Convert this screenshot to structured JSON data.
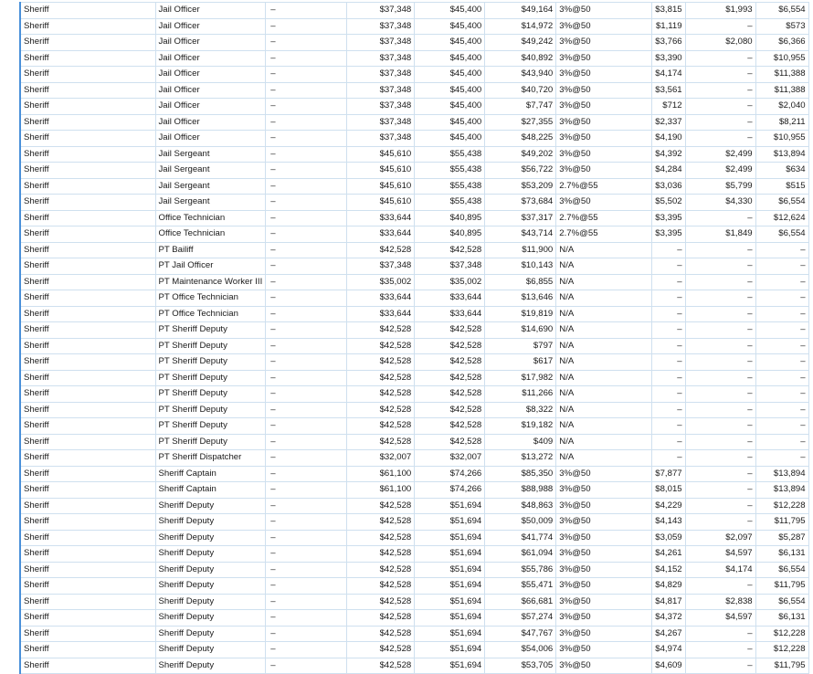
{
  "rows": [
    {
      "dept": "Sheriff",
      "title": "Jail Officer",
      "dash": "–",
      "min": "$37,348",
      "max": "$45,400",
      "pay": "$49,164",
      "ret": "3%@50",
      "h": "$3,815",
      "i": "$1,993",
      "j": "$6,554"
    },
    {
      "dept": "Sheriff",
      "title": "Jail Officer",
      "dash": "–",
      "min": "$37,348",
      "max": "$45,400",
      "pay": "$14,972",
      "ret": "3%@50",
      "h": "$1,119",
      "i": "–",
      "j": "$573"
    },
    {
      "dept": "Sheriff",
      "title": "Jail Officer",
      "dash": "–",
      "min": "$37,348",
      "max": "$45,400",
      "pay": "$49,242",
      "ret": "3%@50",
      "h": "$3,766",
      "i": "$2,080",
      "j": "$6,366"
    },
    {
      "dept": "Sheriff",
      "title": "Jail Officer",
      "dash": "–",
      "min": "$37,348",
      "max": "$45,400",
      "pay": "$40,892",
      "ret": "3%@50",
      "h": "$3,390",
      "i": "–",
      "j": "$10,955"
    },
    {
      "dept": "Sheriff",
      "title": "Jail Officer",
      "dash": "–",
      "min": "$37,348",
      "max": "$45,400",
      "pay": "$43,940",
      "ret": "3%@50",
      "h": "$4,174",
      "i": "–",
      "j": "$11,388"
    },
    {
      "dept": "Sheriff",
      "title": "Jail Officer",
      "dash": "–",
      "min": "$37,348",
      "max": "$45,400",
      "pay": "$40,720",
      "ret": "3%@50",
      "h": "$3,561",
      "i": "–",
      "j": "$11,388"
    },
    {
      "dept": "Sheriff",
      "title": "Jail Officer",
      "dash": "–",
      "min": "$37,348",
      "max": "$45,400",
      "pay": "$7,747",
      "ret": "3%@50",
      "h": "$712",
      "i": "–",
      "j": "$2,040"
    },
    {
      "dept": "Sheriff",
      "title": "Jail Officer",
      "dash": "–",
      "min": "$37,348",
      "max": "$45,400",
      "pay": "$27,355",
      "ret": "3%@50",
      "h": "$2,337",
      "i": "–",
      "j": "$8,211"
    },
    {
      "dept": "Sheriff",
      "title": "Jail Officer",
      "dash": "–",
      "min": "$37,348",
      "max": "$45,400",
      "pay": "$48,225",
      "ret": "3%@50",
      "h": "$4,190",
      "i": "–",
      "j": "$10,955"
    },
    {
      "dept": "Sheriff",
      "title": "Jail Sergeant",
      "dash": "–",
      "min": "$45,610",
      "max": "$55,438",
      "pay": "$49,202",
      "ret": "3%@50",
      "h": "$4,392",
      "i": "$2,499",
      "j": "$13,894"
    },
    {
      "dept": "Sheriff",
      "title": "Jail Sergeant",
      "dash": "–",
      "min": "$45,610",
      "max": "$55,438",
      "pay": "$56,722",
      "ret": "3%@50",
      "h": "$4,284",
      "i": "$2,499",
      "j": "$634"
    },
    {
      "dept": "Sheriff",
      "title": "Jail Sergeant",
      "dash": "–",
      "min": "$45,610",
      "max": "$55,438",
      "pay": "$53,209",
      "ret": "2.7%@55",
      "h": "$3,036",
      "i": "$5,799",
      "j": "$515"
    },
    {
      "dept": "Sheriff",
      "title": "Jail Sergeant",
      "dash": "–",
      "min": "$45,610",
      "max": "$55,438",
      "pay": "$73,684",
      "ret": "3%@50",
      "h": "$5,502",
      "i": "$4,330",
      "j": "$6,554"
    },
    {
      "dept": "Sheriff",
      "title": "Office Technician",
      "dash": "–",
      "min": "$33,644",
      "max": "$40,895",
      "pay": "$37,317",
      "ret": "2.7%@55",
      "h": "$3,395",
      "i": "–",
      "j": "$12,624"
    },
    {
      "dept": "Sheriff",
      "title": "Office Technician",
      "dash": "–",
      "min": "$33,644",
      "max": "$40,895",
      "pay": "$43,714",
      "ret": "2.7%@55",
      "h": "$3,395",
      "i": "$1,849",
      "j": "$6,554"
    },
    {
      "dept": "Sheriff",
      "title": "PT Bailiff",
      "dash": "–",
      "min": "$42,528",
      "max": "$42,528",
      "pay": "$11,900",
      "ret": "N/A",
      "h": "–",
      "i": "–",
      "j": "–"
    },
    {
      "dept": "Sheriff",
      "title": "PT Jail Officer",
      "dash": "–",
      "min": "$37,348",
      "max": "$37,348",
      "pay": "$10,143",
      "ret": "N/A",
      "h": "–",
      "i": "–",
      "j": "–"
    },
    {
      "dept": "Sheriff",
      "title": "PT Maintenance Worker III",
      "dash": "–",
      "min": "$35,002",
      "max": "$35,002",
      "pay": "$6,855",
      "ret": "N/A",
      "h": "–",
      "i": "–",
      "j": "–"
    },
    {
      "dept": "Sheriff",
      "title": "PT Office Technician",
      "dash": "–",
      "min": "$33,644",
      "max": "$33,644",
      "pay": "$13,646",
      "ret": "N/A",
      "h": "–",
      "i": "–",
      "j": "–"
    },
    {
      "dept": "Sheriff",
      "title": "PT Office Technician",
      "dash": "–",
      "min": "$33,644",
      "max": "$33,644",
      "pay": "$19,819",
      "ret": "N/A",
      "h": "–",
      "i": "–",
      "j": "–"
    },
    {
      "dept": "Sheriff",
      "title": "PT Sheriff Deputy",
      "dash": "–",
      "min": "$42,528",
      "max": "$42,528",
      "pay": "$14,690",
      "ret": "N/A",
      "h": "–",
      "i": "–",
      "j": "–"
    },
    {
      "dept": "Sheriff",
      "title": "PT Sheriff Deputy",
      "dash": "–",
      "min": "$42,528",
      "max": "$42,528",
      "pay": "$797",
      "ret": "N/A",
      "h": "–",
      "i": "–",
      "j": "–"
    },
    {
      "dept": "Sheriff",
      "title": "PT Sheriff Deputy",
      "dash": "–",
      "min": "$42,528",
      "max": "$42,528",
      "pay": "$617",
      "ret": "N/A",
      "h": "–",
      "i": "–",
      "j": "–"
    },
    {
      "dept": "Sheriff",
      "title": "PT Sheriff Deputy",
      "dash": "–",
      "min": "$42,528",
      "max": "$42,528",
      "pay": "$17,982",
      "ret": "N/A",
      "h": "–",
      "i": "–",
      "j": "–"
    },
    {
      "dept": "Sheriff",
      "title": "PT Sheriff Deputy",
      "dash": "–",
      "min": "$42,528",
      "max": "$42,528",
      "pay": "$11,266",
      "ret": "N/A",
      "h": "–",
      "i": "–",
      "j": "–"
    },
    {
      "dept": "Sheriff",
      "title": "PT Sheriff Deputy",
      "dash": "–",
      "min": "$42,528",
      "max": "$42,528",
      "pay": "$8,322",
      "ret": "N/A",
      "h": "–",
      "i": "–",
      "j": "–"
    },
    {
      "dept": "Sheriff",
      "title": "PT Sheriff Deputy",
      "dash": "–",
      "min": "$42,528",
      "max": "$42,528",
      "pay": "$19,182",
      "ret": "N/A",
      "h": "–",
      "i": "–",
      "j": "–"
    },
    {
      "dept": "Sheriff",
      "title": "PT Sheriff Deputy",
      "dash": "–",
      "min": "$42,528",
      "max": "$42,528",
      "pay": "$409",
      "ret": "N/A",
      "h": "–",
      "i": "–",
      "j": "–"
    },
    {
      "dept": "Sheriff",
      "title": "PT Sheriff Dispatcher",
      "dash": "–",
      "min": "$32,007",
      "max": "$32,007",
      "pay": "$13,272",
      "ret": "N/A",
      "h": "–",
      "i": "–",
      "j": "–"
    },
    {
      "dept": "Sheriff",
      "title": "Sheriff Captain",
      "dash": "–",
      "min": "$61,100",
      "max": "$74,266",
      "pay": "$85,350",
      "ret": "3%@50",
      "h": "$7,877",
      "i": "–",
      "j": "$13,894"
    },
    {
      "dept": "Sheriff",
      "title": "Sheriff Captain",
      "dash": "–",
      "min": "$61,100",
      "max": "$74,266",
      "pay": "$88,988",
      "ret": "3%@50",
      "h": "$8,015",
      "i": "–",
      "j": "$13,894"
    },
    {
      "dept": "Sheriff",
      "title": "Sheriff Deputy",
      "dash": "–",
      "min": "$42,528",
      "max": "$51,694",
      "pay": "$48,863",
      "ret": "3%@50",
      "h": "$4,229",
      "i": "–",
      "j": "$12,228"
    },
    {
      "dept": "Sheriff",
      "title": "Sheriff Deputy",
      "dash": "–",
      "min": "$42,528",
      "max": "$51,694",
      "pay": "$50,009",
      "ret": "3%@50",
      "h": "$4,143",
      "i": "–",
      "j": "$11,795"
    },
    {
      "dept": "Sheriff",
      "title": "Sheriff Deputy",
      "dash": "–",
      "min": "$42,528",
      "max": "$51,694",
      "pay": "$41,774",
      "ret": "3%@50",
      "h": "$3,059",
      "i": "$2,097",
      "j": "$5,287"
    },
    {
      "dept": "Sheriff",
      "title": "Sheriff Deputy",
      "dash": "–",
      "min": "$42,528",
      "max": "$51,694",
      "pay": "$61,094",
      "ret": "3%@50",
      "h": "$4,261",
      "i": "$4,597",
      "j": "$6,131"
    },
    {
      "dept": "Sheriff",
      "title": "Sheriff Deputy",
      "dash": "–",
      "min": "$42,528",
      "max": "$51,694",
      "pay": "$55,786",
      "ret": "3%@50",
      "h": "$4,152",
      "i": "$4,174",
      "j": "$6,554"
    },
    {
      "dept": "Sheriff",
      "title": "Sheriff Deputy",
      "dash": "–",
      "min": "$42,528",
      "max": "$51,694",
      "pay": "$55,471",
      "ret": "3%@50",
      "h": "$4,829",
      "i": "–",
      "j": "$11,795"
    },
    {
      "dept": "Sheriff",
      "title": "Sheriff Deputy",
      "dash": "–",
      "min": "$42,528",
      "max": "$51,694",
      "pay": "$66,681",
      "ret": "3%@50",
      "h": "$4,817",
      "i": "$2,838",
      "j": "$6,554"
    },
    {
      "dept": "Sheriff",
      "title": "Sheriff Deputy",
      "dash": "–",
      "min": "$42,528",
      "max": "$51,694",
      "pay": "$57,274",
      "ret": "3%@50",
      "h": "$4,372",
      "i": "$4,597",
      "j": "$6,131"
    },
    {
      "dept": "Sheriff",
      "title": "Sheriff Deputy",
      "dash": "–",
      "min": "$42,528",
      "max": "$51,694",
      "pay": "$47,767",
      "ret": "3%@50",
      "h": "$4,267",
      "i": "–",
      "j": "$12,228"
    },
    {
      "dept": "Sheriff",
      "title": "Sheriff Deputy",
      "dash": "–",
      "min": "$42,528",
      "max": "$51,694",
      "pay": "$54,006",
      "ret": "3%@50",
      "h": "$4,974",
      "i": "–",
      "j": "$12,228"
    },
    {
      "dept": "Sheriff",
      "title": "Sheriff Deputy",
      "dash": "–",
      "min": "$42,528",
      "max": "$51,694",
      "pay": "$53,705",
      "ret": "3%@50",
      "h": "$4,609",
      "i": "–",
      "j": "$11,795"
    }
  ]
}
